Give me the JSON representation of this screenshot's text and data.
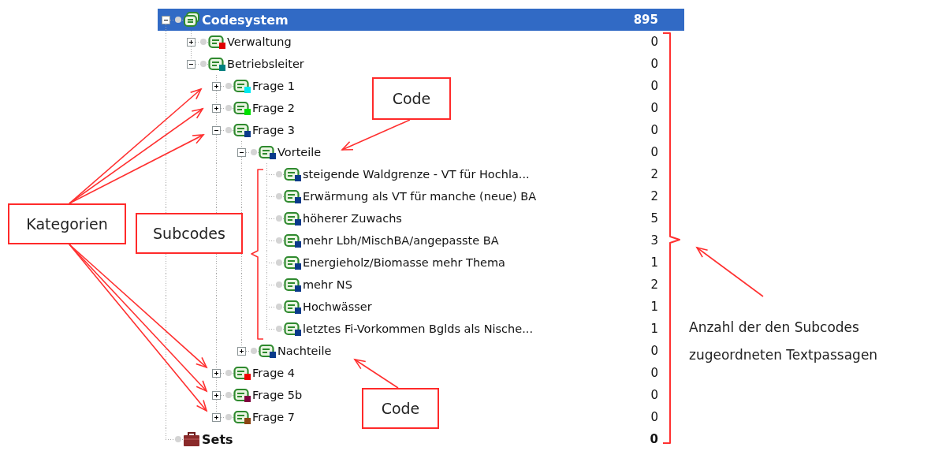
{
  "code_tree": [
    {
      "kind": "root",
      "label": "Codesystem",
      "count": "895",
      "selected": true,
      "expanded": true,
      "children": [
        {
          "kind": "code",
          "label": "Verwaltung",
          "count": "0",
          "selected": false,
          "expanded": false,
          "color": "#e00000"
        },
        {
          "kind": "code",
          "label": "Betriebsleiter",
          "count": "0",
          "selected": false,
          "expanded": true,
          "color": "#008080",
          "children": [
            {
              "kind": "code",
              "label": "Frage 1",
              "count": "0",
              "selected": false,
              "expanded": false,
              "color": "#00e8f0"
            },
            {
              "kind": "code",
              "label": "Frage 2",
              "count": "0",
              "selected": false,
              "expanded": false,
              "color": "#00e000"
            },
            {
              "kind": "code",
              "label": "Frage 3",
              "count": "0",
              "selected": false,
              "expanded": true,
              "color": "#0a3a8a",
              "children": [
                {
                  "kind": "code",
                  "label": "Vorteile",
                  "count": "0",
                  "selected": false,
                  "expanded": true,
                  "color": "#0a3a8a",
                  "children": [
                    {
                      "kind": "code",
                      "label": "steigende Waldgrenze - VT für Hochla...",
                      "count": "2",
                      "selected": false,
                      "color": "#0a3a8a"
                    },
                    {
                      "kind": "code",
                      "label": "Erwärmung als VT für manche (neue) BA",
                      "count": "2",
                      "selected": false,
                      "color": "#0a3a8a"
                    },
                    {
                      "kind": "code",
                      "label": "höherer Zuwachs",
                      "count": "5",
                      "selected": false,
                      "color": "#0a3a8a"
                    },
                    {
                      "kind": "code",
                      "label": "mehr Lbh/MischBA/angepasste BA",
                      "count": "3",
                      "selected": false,
                      "color": "#0a3a8a"
                    },
                    {
                      "kind": "code",
                      "label": "Energieholz/Biomasse mehr Thema",
                      "count": "1",
                      "selected": false,
                      "color": "#0a3a8a"
                    },
                    {
                      "kind": "code",
                      "label": "mehr NS",
                      "count": "2",
                      "selected": false,
                      "color": "#0a3a8a"
                    },
                    {
                      "kind": "code",
                      "label": "Hochwässer",
                      "count": "1",
                      "selected": false,
                      "color": "#0a3a8a"
                    },
                    {
                      "kind": "code",
                      "label": "letztes Fi-Vorkommen Bglds als Nische...",
                      "count": "1",
                      "selected": false,
                      "color": "#0a3a8a"
                    }
                  ]
                },
                {
                  "kind": "code",
                  "label": "Nachteile",
                  "count": "0",
                  "selected": false,
                  "expanded": false,
                  "color": "#0a3a8a"
                }
              ]
            },
            {
              "kind": "code",
              "label": "Frage 4",
              "count": "0",
              "selected": false,
              "expanded": false,
              "color": "#ee0000"
            },
            {
              "kind": "code",
              "label": "Frage 5b",
              "count": "0",
              "selected": false,
              "expanded": false,
              "color": "#800040"
            },
            {
              "kind": "code",
              "label": "Frage 7",
              "count": "0",
              "selected": false,
              "expanded": false,
              "color": "#8b4513"
            }
          ]
        }
      ]
    },
    {
      "kind": "set",
      "label": "Sets",
      "count": "0",
      "selected": false
    }
  ],
  "annotations": [
    {
      "kind": "callout",
      "text": "Code"
    },
    {
      "kind": "callout",
      "text": "Kategorien"
    },
    {
      "kind": "callout",
      "text": "Subcodes"
    },
    {
      "kind": "note",
      "text": "Anzahl der den Subcodes zugeordneten Textpassagen"
    },
    {
      "kind": "callout",
      "text": "Code"
    }
  ]
}
